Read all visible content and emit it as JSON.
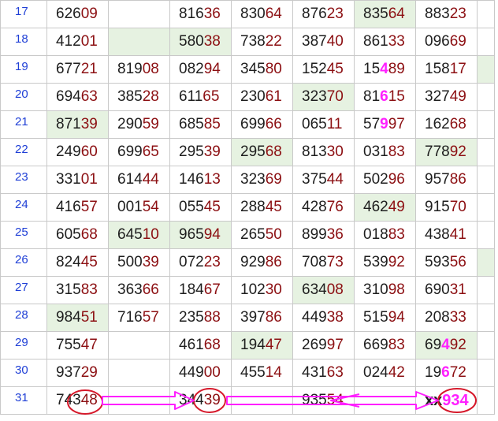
{
  "grid": {
    "rows": [
      {
        "n": "17",
        "cells": [
          {
            "a": "626",
            "b": "09"
          },
          {
            "a": "",
            "b": ""
          },
          {
            "a": "816",
            "b": "36"
          },
          {
            "a": "830",
            "b": "64"
          },
          {
            "a": "876",
            "b": "23"
          },
          {
            "a": "835",
            "b": "64",
            "g": 1
          },
          {
            "a": "883",
            "b": "23"
          },
          {
            "a": "",
            "b": ""
          }
        ]
      },
      {
        "n": "18",
        "cells": [
          {
            "a": "412",
            "b": "01"
          },
          {
            "a": "",
            "b": "",
            "g": 1
          },
          {
            "a": "580",
            "b": "38",
            "g": 1
          },
          {
            "a": "738",
            "b": "22"
          },
          {
            "a": "387",
            "b": "40"
          },
          {
            "a": "861",
            "b": "33"
          },
          {
            "a": "096",
            "b": "69"
          },
          {
            "a": "",
            "b": ""
          }
        ]
      },
      {
        "n": "19",
        "cells": [
          {
            "a": "677",
            "b": "21"
          },
          {
            "a": "819",
            "b": "08"
          },
          {
            "a": "082",
            "b": "94"
          },
          {
            "a": "345",
            "b": "80"
          },
          {
            "a": "152",
            "b": "45"
          },
          {
            "a": "15",
            "h": "4",
            "b2": "89"
          },
          {
            "a": "158",
            "b": "17"
          },
          {
            "a": "",
            "b": "",
            "g": 1
          }
        ]
      },
      {
        "n": "20",
        "cells": [
          {
            "a": "694",
            "b": "63"
          },
          {
            "a": "385",
            "b": "28"
          },
          {
            "a": "611",
            "b": "65"
          },
          {
            "a": "230",
            "b": "61"
          },
          {
            "a": "323",
            "b": "70",
            "g": 1
          },
          {
            "a": "81",
            "h": "6",
            "b2": "15"
          },
          {
            "a": "327",
            "b": "49"
          },
          {
            "a": "",
            "b": ""
          }
        ]
      },
      {
        "n": "21",
        "cells": [
          {
            "a": "871",
            "b": "39",
            "g": 1
          },
          {
            "a": "290",
            "b": "59"
          },
          {
            "a": "685",
            "b": "85"
          },
          {
            "a": "699",
            "b": "66"
          },
          {
            "a": "065",
            "b": "11"
          },
          {
            "a": "57",
            "h": "9",
            "b2": "97"
          },
          {
            "a": "162",
            "b": "68"
          },
          {
            "a": "",
            "b": ""
          }
        ]
      },
      {
        "n": "22",
        "cells": [
          {
            "a": "249",
            "b": "60"
          },
          {
            "a": "699",
            "b": "65"
          },
          {
            "a": "295",
            "b": "39"
          },
          {
            "a": "295",
            "b": "68",
            "g": 1
          },
          {
            "a": "813",
            "b": "30"
          },
          {
            "a": "031",
            "b": "83"
          },
          {
            "a": "778",
            "b": "92",
            "g": 1
          },
          {
            "a": "",
            "b": ""
          }
        ]
      },
      {
        "n": "23",
        "cells": [
          {
            "a": "331",
            "b": "01"
          },
          {
            "a": "614",
            "b": "44"
          },
          {
            "a": "146",
            "b": "13"
          },
          {
            "a": "323",
            "b": "69"
          },
          {
            "a": "375",
            "b": "44"
          },
          {
            "a": "502",
            "b": "96"
          },
          {
            "a": "957",
            "b": "86"
          },
          {
            "a": "",
            "b": ""
          }
        ]
      },
      {
        "n": "24",
        "cells": [
          {
            "a": "416",
            "b": "57"
          },
          {
            "a": "001",
            "b": "54"
          },
          {
            "a": "055",
            "b": "45"
          },
          {
            "a": "288",
            "b": "45"
          },
          {
            "a": "428",
            "b": "76"
          },
          {
            "a": "462",
            "b": "49",
            "g": 1
          },
          {
            "a": "915",
            "b": "70"
          },
          {
            "a": "",
            "b": ""
          }
        ]
      },
      {
        "n": "25",
        "cells": [
          {
            "a": "605",
            "b": "68"
          },
          {
            "a": "645",
            "b": "10",
            "g": 1
          },
          {
            "a": "965",
            "b": "94",
            "g": 1
          },
          {
            "a": "265",
            "b": "50"
          },
          {
            "a": "899",
            "b": "36"
          },
          {
            "a": "018",
            "b": "83"
          },
          {
            "a": "438",
            "b": "41"
          },
          {
            "a": "",
            "b": ""
          }
        ]
      },
      {
        "n": "26",
        "cells": [
          {
            "a": "824",
            "b": "45"
          },
          {
            "a": "500",
            "b": "39"
          },
          {
            "a": "072",
            "b": "23"
          },
          {
            "a": "929",
            "b": "86"
          },
          {
            "a": "708",
            "b": "73"
          },
          {
            "a": "539",
            "b": "92"
          },
          {
            "a": "593",
            "b": "56"
          },
          {
            "a": "",
            "b": "",
            "g": 1
          }
        ]
      },
      {
        "n": "27",
        "cells": [
          {
            "a": "315",
            "b": "83"
          },
          {
            "a": "363",
            "b": "66"
          },
          {
            "a": "184",
            "b": "67"
          },
          {
            "a": "102",
            "b": "30"
          },
          {
            "a": "634",
            "b": "08",
            "g": 1
          },
          {
            "a": "310",
            "b": "98"
          },
          {
            "a": "690",
            "b": "31"
          },
          {
            "a": "",
            "b": ""
          }
        ]
      },
      {
        "n": "28",
        "cells": [
          {
            "a": "984",
            "b": "51",
            "g": 1
          },
          {
            "a": "716",
            "b": "57"
          },
          {
            "a": "235",
            "b": "88"
          },
          {
            "a": "397",
            "b": "86"
          },
          {
            "a": "449",
            "b": "38"
          },
          {
            "a": "515",
            "b": "94"
          },
          {
            "a": "208",
            "b": "33"
          },
          {
            "a": "",
            "b": ""
          }
        ]
      },
      {
        "n": "29",
        "cells": [
          {
            "a": "755",
            "b": "47"
          },
          {
            "a": "",
            "b": ""
          },
          {
            "a": "461",
            "b": "68"
          },
          {
            "a": "194",
            "b": "47",
            "g": 1
          },
          {
            "a": "269",
            "b": "97"
          },
          {
            "a": "669",
            "b": "83"
          },
          {
            "a": "69",
            "h": "4",
            "b2": "92",
            "g": 1
          },
          {
            "a": "",
            "b": ""
          }
        ]
      },
      {
        "n": "30",
        "cells": [
          {
            "a": "937",
            "b": "29"
          },
          {
            "a": "",
            "b": ""
          },
          {
            "a": "449",
            "b": "00"
          },
          {
            "a": "455",
            "b": "14"
          },
          {
            "a": "431",
            "b": "63"
          },
          {
            "a": "024",
            "b": "42"
          },
          {
            "a": "19",
            "h": "6",
            "b2": "72"
          },
          {
            "a": "",
            "b": ""
          }
        ]
      },
      {
        "n": "31",
        "cells": [
          {
            "a": "743",
            "b": "48"
          },
          {
            "a": "",
            "b": ""
          },
          {
            "a": "344",
            "b": "39"
          },
          {
            "a": "",
            "b": ""
          },
          {
            "a": "935",
            "b": "54"
          },
          {
            "a": "",
            "b": ""
          },
          {
            "a": "xx",
            "h": "9",
            "b2": "34",
            "big": 1
          },
          {
            "a": "",
            "b": ""
          }
        ]
      }
    ]
  },
  "annotation": {
    "circle_color": "#d6182a",
    "arrow_color": "#ff1fff",
    "green_fill": "#e6f2e1"
  }
}
